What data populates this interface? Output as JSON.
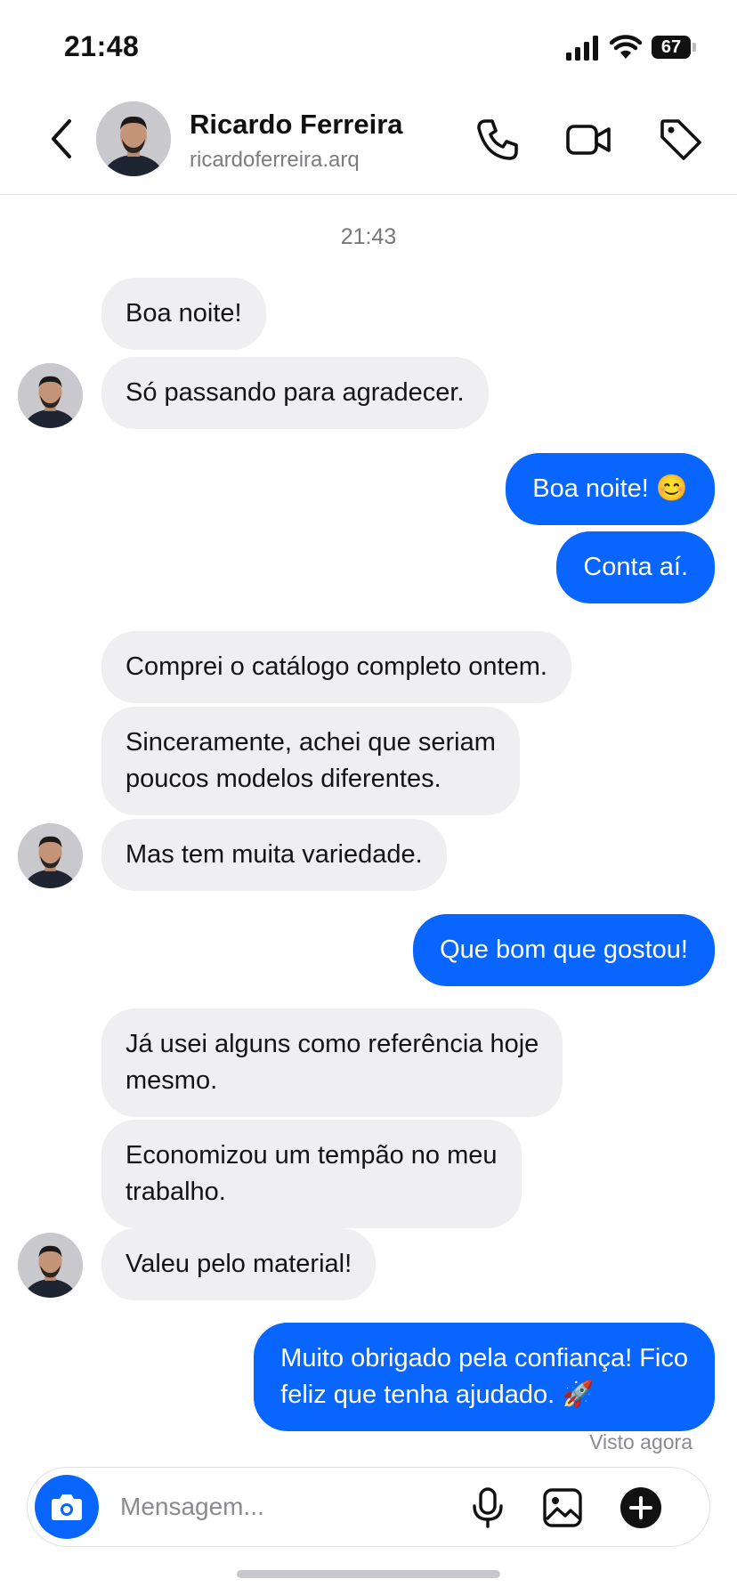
{
  "status_bar": {
    "time": "21:48",
    "battery": "67"
  },
  "header": {
    "contact_name": "Ricardo Ferreira",
    "contact_username": "ricardoferreira.arq",
    "icons": [
      "back-icon",
      "phone-icon",
      "video-icon",
      "tag-icon"
    ]
  },
  "chat": {
    "timestamp": "21:43",
    "messages": [
      {
        "from": "contact",
        "text": "Boa noite!"
      },
      {
        "from": "contact",
        "text": "Só passando para agradecer."
      },
      {
        "from": "me",
        "text": "Boa noite! 😊"
      },
      {
        "from": "me",
        "text": "Conta aí."
      },
      {
        "from": "contact",
        "text": "Comprei o catálogo completo ontem."
      },
      {
        "from": "contact",
        "text": "Sinceramente, achei que seriam\npoucos modelos diferentes."
      },
      {
        "from": "contact",
        "text": "Mas tem muita variedade."
      },
      {
        "from": "me",
        "text": "Que bom que gostou!"
      },
      {
        "from": "contact",
        "text": "Já usei alguns como referência hoje\nmesmo."
      },
      {
        "from": "contact",
        "text": "Economizou um tempão no meu\ntrabalho."
      },
      {
        "from": "contact",
        "text": "Valeu pelo material!"
      },
      {
        "from": "me",
        "text": "Muito obrigado pela confiança! Fico\nfeliz que tenha ajudado. 🚀"
      }
    ],
    "seen_status": "Visto agora"
  },
  "composer": {
    "placeholder": "Mensagem...",
    "icons": [
      "camera-icon",
      "microphone-icon",
      "gallery-icon",
      "plus-icon"
    ]
  },
  "colors": {
    "accent": "#0866ff",
    "incoming_bubble": "#efeff1",
    "text_muted": "#7b7b80"
  }
}
